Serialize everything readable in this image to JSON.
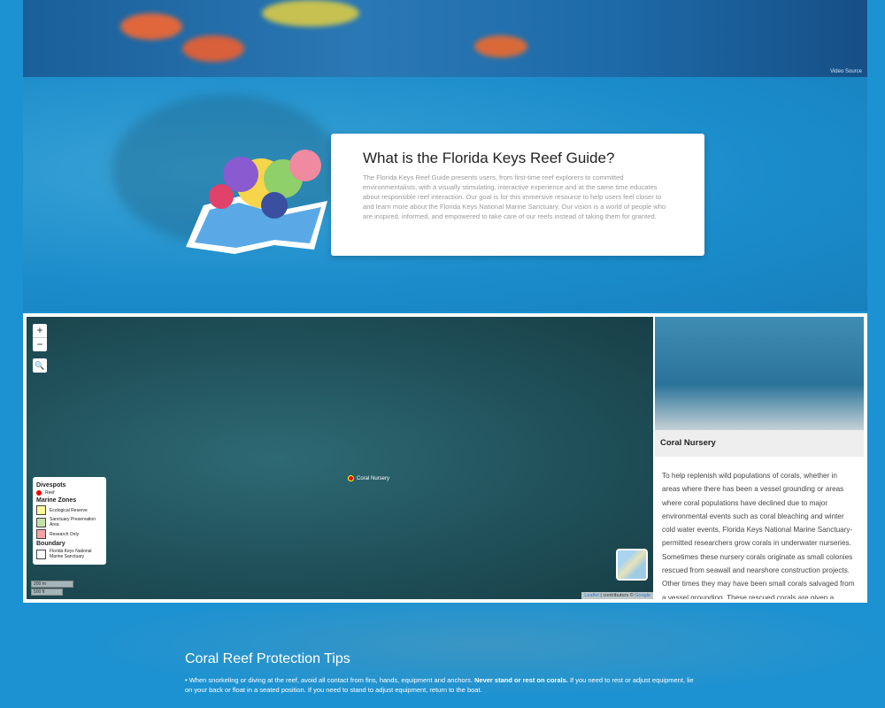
{
  "video": {
    "source_label": "Video Source"
  },
  "intro": {
    "title": "What is the Florida Keys Reef Guide?",
    "body": "The Florida Keys Reef Guide presents users, from first-time reef explorers to committed environmentalists, with a visually stimulating, interactive experience and at the same time educates about responsible reef interaction. Our goal is for this immersive resource to help users feel closer to and learn more about the Florida Keys National Marine Sanctuary. Our vision is a world of people who are inspired, informed, and empowered to take care of our reefs instead of taking them for granted."
  },
  "map": {
    "zoom_in": "+",
    "zoom_out": "−",
    "search_icon": "search-icon",
    "marker_label": "Coral Nursery",
    "legend": {
      "divespots": "Divespots",
      "reef": "Reef",
      "marine_zones": "Marine Zones",
      "zones": [
        {
          "label": "Ecological Reserve",
          "color": "#fbfb9b"
        },
        {
          "label": "Sanctuary Preservation Area",
          "color": "#c5e0a5"
        },
        {
          "label": "Research Only",
          "color": "#f5a3a3"
        }
      ],
      "boundary": "Boundary",
      "boundary_label": "Florida Keys National Marine Sanctuary"
    },
    "scale_m": "200 m",
    "scale_ft": "500 ft",
    "attribution": {
      "leaflet": "Leaflet",
      "middle": " | contributors © ",
      "google": "Google"
    }
  },
  "panel": {
    "title": "Coral Nursery",
    "text": "To help replenish wild populations of corals, whether in areas where there has been a vessel grounding or areas where coral populations have declined due to major environmental events such as coral bleaching and winter cold water events, Florida Keys National Marine Sanctuary-permitted researchers grow corals in underwater nurseries. Sometimes these nursery corals originate as small colonies rescued from seawall and nearshore construction projects. Other times they may have been small corals salvaged from a vessel grounding. These rescued corals are given a second"
  },
  "tips": {
    "title": "Coral Reef Protection Tips",
    "tip1_a": "When snorkeling or diving at the reef, avoid all contact from fins, hands, equipment and anchors. ",
    "tip1_bold": "Never stand or rest on corals.",
    "tip1_b": " If you need to rest or adjust equipment, lie on your back or float in a seated position. If you need to stand to adjust equipment, return to the boat."
  }
}
